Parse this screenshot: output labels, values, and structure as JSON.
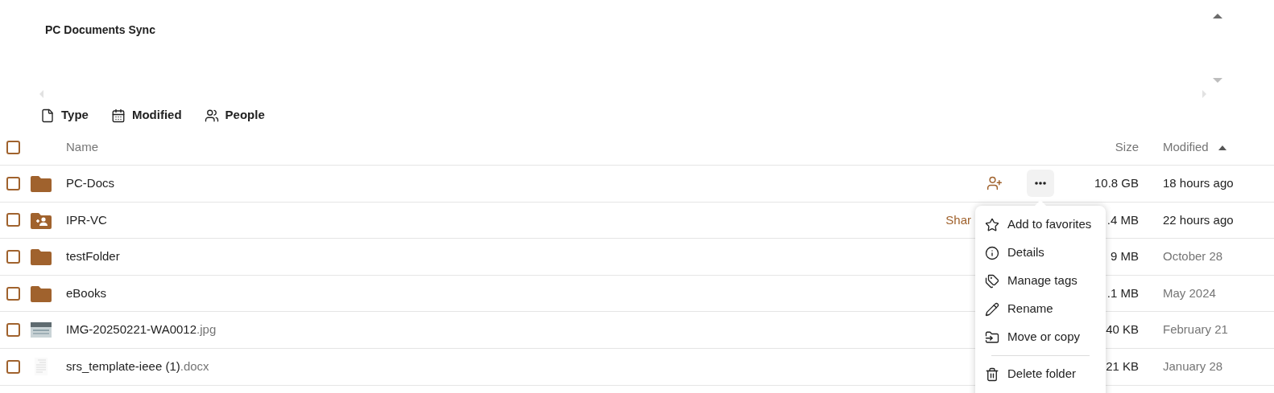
{
  "title": "PC Documents Sync",
  "filters": [
    {
      "label": "Type",
      "kind": "type"
    },
    {
      "label": "Modified",
      "kind": "date"
    },
    {
      "label": "People",
      "kind": "people"
    }
  ],
  "header": {
    "checked": false,
    "columns": [
      {
        "label": "Name",
        "sorted": false
      },
      {
        "label": "Size",
        "sorted": false
      },
      {
        "label": "Modified",
        "sorted": true
      }
    ]
  },
  "rows": [
    {
      "kind": "folder",
      "name": "PC-Docs",
      "checked": false,
      "size": "10.8 GB",
      "modified": "18 hours ago",
      "recent": true,
      "actions": true
    },
    {
      "kind": "shared-folder",
      "name": "IPR-VC",
      "checked": false,
      "share_label": "Shar",
      "size": ".4 MB",
      "modified": "22 hours ago",
      "recent": true,
      "actions": false
    },
    {
      "kind": "folder",
      "name": "testFolder",
      "checked": false,
      "size": "9 MB",
      "modified": "October 28",
      "recent": false,
      "actions": false
    },
    {
      "kind": "folder",
      "name": "eBooks",
      "checked": false,
      "size": ".1 MB",
      "modified": "May 2024",
      "recent": false,
      "actions": false
    },
    {
      "kind": "image",
      "name": "IMG-20250221-WA0012",
      "ext": ".jpg",
      "checked": false,
      "size": "40 KB",
      "modified": "February 21",
      "recent": false,
      "actions": false
    },
    {
      "kind": "document",
      "name": "srs_template-ieee (1)",
      "ext": ".docx",
      "checked": false,
      "size": "21 KB",
      "modified": "January 28",
      "recent": false,
      "actions": false
    }
  ],
  "menu": {
    "items": [
      {
        "label": "Add to favorites",
        "kind": "star",
        "divider_before": false
      },
      {
        "label": "Details",
        "kind": "info",
        "divider_before": false
      },
      {
        "label": "Manage tags",
        "kind": "tag",
        "divider_before": false
      },
      {
        "label": "Rename",
        "kind": "pencil",
        "divider_before": false
      },
      {
        "label": "Move or copy",
        "kind": "move",
        "divider_before": false
      },
      {
        "label": "Delete folder",
        "kind": "trash",
        "divider_before": true
      }
    ]
  }
}
